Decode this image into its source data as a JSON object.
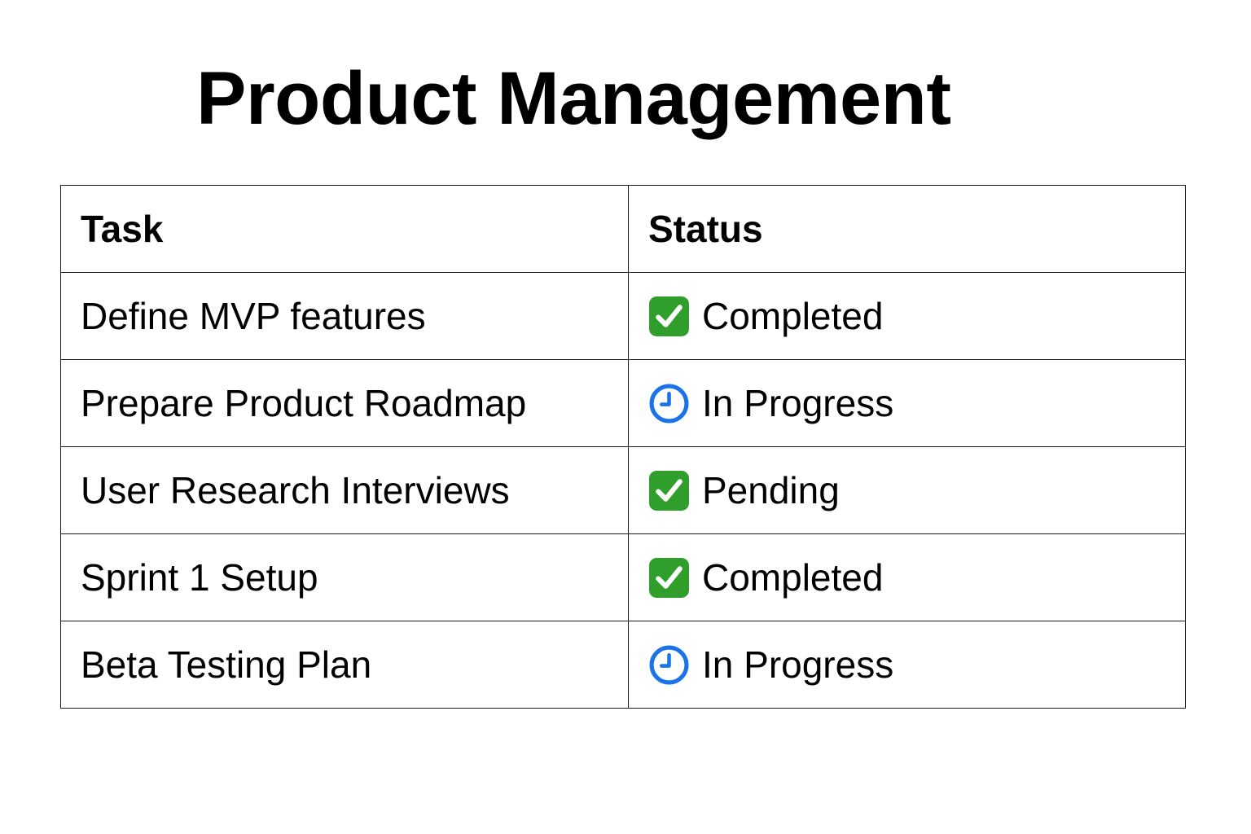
{
  "page": {
    "title": "Product Management"
  },
  "table": {
    "headers": {
      "task": "Task",
      "status": "Status"
    },
    "rows": [
      {
        "task": "Define MVP features",
        "status": "Completed",
        "status_icon": "check-mark-icon"
      },
      {
        "task": "Prepare Product Roadmap",
        "status": "In Progress",
        "status_icon": "clock-icon"
      },
      {
        "task": "User Research Interviews",
        "status": "Pending",
        "status_icon": "check-mark-icon"
      },
      {
        "task": "Sprint 1 Setup",
        "status": "Completed",
        "status_icon": "check-mark-icon"
      },
      {
        "task": "Beta Testing Plan",
        "status": "In Progress",
        "status_icon": "clock-icon"
      }
    ]
  },
  "colors": {
    "check_green": "#2f9e2a",
    "clock_blue": "#1a73e8",
    "border": "#1a1a1a",
    "text": "#000000"
  }
}
